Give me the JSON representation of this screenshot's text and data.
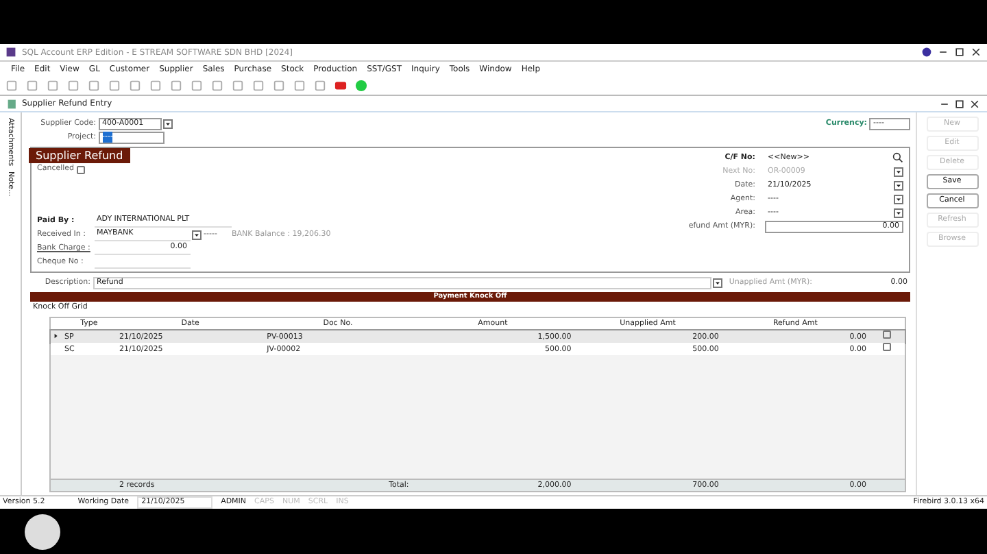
{
  "app_title": "SQL Account ERP Edition - E STREAM SOFTWARE SDN BHD [2024]",
  "menu": [
    "File",
    "Edit",
    "View",
    "GL",
    "Customer",
    "Supplier",
    "Sales",
    "Purchase",
    "Stock",
    "Production",
    "SST/GST",
    "Inquiry",
    "Tools",
    "Window",
    "Help"
  ],
  "window": {
    "title": "Supplier Refund Entry"
  },
  "side_tabs": [
    "Attachments",
    "Note..."
  ],
  "header": {
    "supplier_code_label": "Supplier Code:",
    "supplier_code": "400-A0001",
    "project_label": "Project:",
    "project": "----",
    "currency_label": "Currency:",
    "currency": "----"
  },
  "section": {
    "title": "Supplier Refund",
    "cancelled_label": "Cancelled",
    "cancelled": false,
    "left_fields": [
      {
        "label": "Paid By :",
        "value": "ADY INTERNATIONAL PLT",
        "kind": "text"
      },
      {
        "label": "Received In :",
        "value": "MAYBANK",
        "kind": "combo",
        "extra": "-----",
        "balance": "BANK Balance : 19,206.30"
      },
      {
        "label": "Bank Charge :",
        "value": "0.00",
        "kind": "amount"
      },
      {
        "label": "Cheque No :",
        "kind": "text"
      }
    ],
    "right_fields": [
      {
        "label": "C/F No:",
        "value": "<<New>>",
        "kind": "search",
        "disabled": false
      },
      {
        "label": "Next No:",
        "value": "OR-00009",
        "kind": "combo",
        "disabled": true
      },
      {
        "label": "Date:",
        "value": "21/10/2025",
        "kind": "combo",
        "disabled": false
      },
      {
        "label": "Agent:",
        "value": "----",
        "kind": "combo",
        "disabled": false
      },
      {
        "label": "Area:",
        "value": "----",
        "kind": "combo",
        "disabled": false
      },
      {
        "label": "efund Amt (MYR):",
        "value": "0.00",
        "kind": "amount",
        "disabled": false
      }
    ]
  },
  "description": {
    "label": "Description:",
    "value": "Refund",
    "unapplied_label": "Unapplied Amt (MYR):",
    "unapplied": "0.00"
  },
  "band": "Payment Knock Off",
  "grid": {
    "title": "Knock Off Grid",
    "columns": [
      "Type",
      "Date",
      "Doc No.",
      "Amount",
      "Unapplied Amt",
      "Refund Amt"
    ],
    "rows": [
      {
        "cells": [
          "SP",
          "21/10/2025",
          "PV-00013",
          "1,500.00",
          "200.00",
          "0.00"
        ],
        "selected": true,
        "checked": false
      },
      {
        "cells": [
          "SC",
          "21/10/2025",
          "JV-00002",
          "500.00",
          "500.00",
          "0.00"
        ],
        "selected": false,
        "checked": false
      }
    ],
    "footer": {
      "records": "2 records",
      "total_label": "Total:",
      "totals": [
        "2,000.00",
        "700.00",
        "0.00"
      ]
    }
  },
  "side_buttons": [
    {
      "label": "New",
      "disabled": true
    },
    {
      "label": "Edit",
      "disabled": true
    },
    {
      "label": "Delete",
      "disabled": true
    },
    {
      "label": "Save",
      "disabled": false
    },
    {
      "label": "Cancel",
      "disabled": false
    },
    {
      "label": "Refresh",
      "disabled": true
    },
    {
      "label": "Browse",
      "disabled": true
    }
  ],
  "status_bar": {
    "version": "Version 5.2",
    "working_date_label": "Working Date",
    "working_date": "21/10/2025",
    "user": "ADMIN",
    "keys": [
      {
        "label": "CAPS",
        "on": false
      },
      {
        "label": "NUM",
        "on": false
      },
      {
        "label": "SCRL",
        "on": false
      },
      {
        "label": "INS",
        "on": false
      }
    ],
    "db": "Firebird 3.0.13 x64"
  }
}
